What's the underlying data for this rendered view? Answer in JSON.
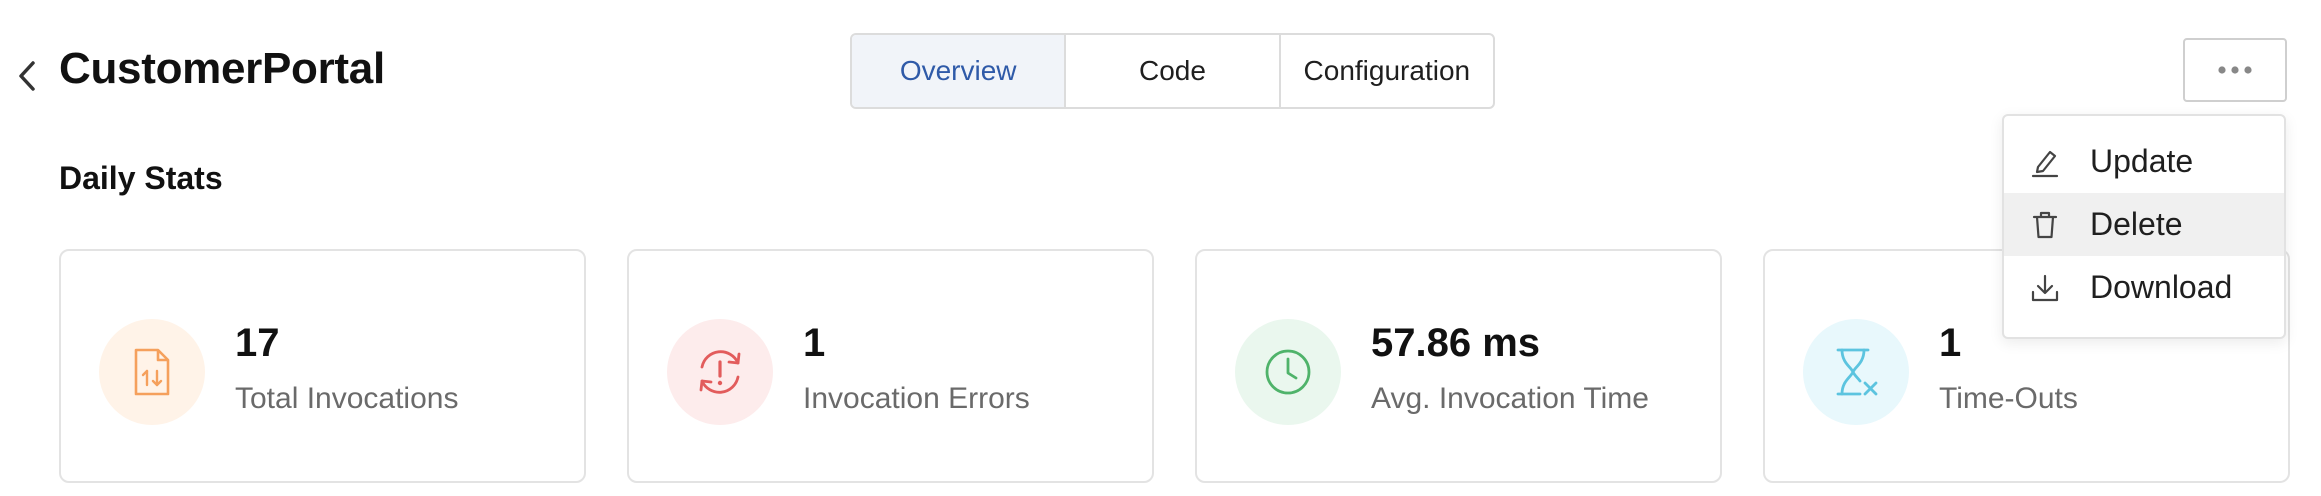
{
  "header": {
    "title": "CustomerPortal",
    "back_icon": "chevron-left-icon"
  },
  "tabs": [
    {
      "label": "Overview",
      "active": true
    },
    {
      "label": "Code",
      "active": false
    },
    {
      "label": "Configuration",
      "active": false
    }
  ],
  "more_button": {
    "icon": "more-horizontal-icon"
  },
  "menu": {
    "items": [
      {
        "label": "Update",
        "icon": "edit-pencil-icon",
        "hovered": false
      },
      {
        "label": "Delete",
        "icon": "trash-icon",
        "hovered": true
      },
      {
        "label": "Download",
        "icon": "download-icon",
        "hovered": false
      }
    ]
  },
  "section": {
    "title": "Daily Stats"
  },
  "stats": [
    {
      "value": "17",
      "label": "Total Invocations",
      "icon": "document-icon",
      "color": "#f5a05c",
      "bg": "#fff3e8"
    },
    {
      "value": "1",
      "label": "Invocation Errors",
      "icon": "error-refresh-icon",
      "color": "#e25c5c",
      "bg": "#fdecec"
    },
    {
      "value": "57.86 ms",
      "label": "Avg. Invocation Time",
      "icon": "clock-icon",
      "color": "#4fb36a",
      "bg": "#eaf7ee"
    },
    {
      "value": "1",
      "label": "Time-Outs",
      "icon": "hourglass-x-icon",
      "color": "#5cc4df",
      "bg": "#e8f8fc"
    }
  ]
}
